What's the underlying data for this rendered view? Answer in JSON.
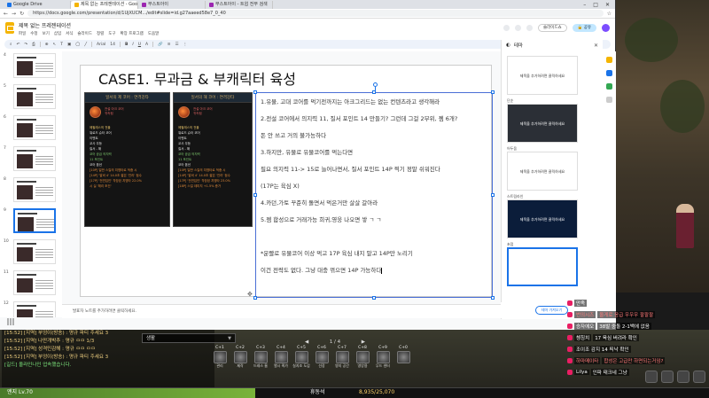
{
  "browser": {
    "tabs": [
      {
        "label": "Google Drive",
        "color": "#1a73e8"
      },
      {
        "label": "제목 없는 프레젠테이션 - Google",
        "color": "#f4b400",
        "active": true
      },
      {
        "label": "부스트아이",
        "color": "#9c27b0"
      },
      {
        "label": "부스트아이 - 트윕 전부 검색",
        "color": "#9c27b0"
      }
    ],
    "url": "https://docs.google.com/presentation/d/1UjXUCM.../edit#slide=id.g27aaeed58e7_0_40"
  },
  "docs": {
    "title": "제목 없는 프레젠테이션",
    "menus": [
      "파일",
      "수정",
      "보기",
      "삽입",
      "서식",
      "슬라이드",
      "정렬",
      "도구",
      "확장 프로그램",
      "도움말"
    ],
    "present_label": "슬라이드쇼",
    "share_label": "공유",
    "toolbar_font": "Arial",
    "toolbar_size": "14",
    "toolbar_items": [
      "B",
      "I",
      "U",
      "A"
    ]
  },
  "filmstrip": {
    "numbers": [
      "4",
      "5",
      "6",
      "7",
      "8",
      "9",
      "10",
      "11",
      "12"
    ],
    "selected_index": 5
  },
  "slide": {
    "title": "CASE1. 무과금 & 부캐릭터 육성",
    "panel_left": {
      "header": "일서의 제 코어 : 연격강타",
      "sub1": "전설 아크 코어",
      "sub2": "귀속됨",
      "lines": [
        "에필레스의 전율",
        "워로드 슈터 코어",
        "이벤트",
        "교사 무등",
        "질서 - 해",
        "코어 공급 의지력",
        "11 포인트",
        "코어 옵션",
        "[10P] 일반 스킬의 치명타로 적중 시",
        "[14P] '알비 4' 14.0초 짧은 '진리' 점수",
        "[17P] '전연입인' 착장된 치명타 22.0%",
        "시 실 '체리 조건'"
      ]
    },
    "panel_right": {
      "header": "일서의 해 코어 : 연격강타",
      "sub1": "전설 아크 코어",
      "sub2": "귀속됨",
      "lines": [
        "에필레스의 전율",
        "워로드 슈터 코어",
        "이벤트",
        "교사 무등",
        "질서 - 해",
        "코어 공급 의지력",
        "11 포인트",
        "코어 옵션",
        "[10P] 일반 스킬의 치명타로 적중 시",
        "[14P] '알비 4' 14.0초 짧은 '진리' 점수",
        "[17P] '전연입인' 착장된 치명타 23.0%",
        "[18P] 스킬 데미지 +1.5% 증가"
      ]
    },
    "text_lines": [
      "1.유물, 고대 코어를 먹기전까지는 아크그리드는 없는 컨텐츠라고 생각해라",
      "2.전설 코어에서 의지력 11, 질서 포인트 14 만들기? 그런데 그걸 2부위, 젬 6개?",
      "돈 안 쓰고 거의 불가능하다",
      "3.하지만, 유물로 유물코어를 먹는다면",
      "필요 의지력 11-> 15로 늘어나면서, 질서 포인트 14P 찍기 정말 쉬워진다",
      "(17P는 육심 X)",
      "4.카던,가토 꾸준히 돌면서 먹은거만 살살 갈아라",
      "5.젬 합성으로 거래가능 희귀,영웅 나오면 쌓 ㄱ ㄱ",
      "",
      "*운빨로 유물코어 이상 먹고 17P 육심 내지 말고 14P만 노리기",
      "이건 전략도 없다. 그냥 대충 꺾으면 14P 가능하다"
    ]
  },
  "notes": {
    "placeholder": "발표자 노트를 추가하려면 클릭하세요."
  },
  "theme": {
    "title": "테마",
    "sections": [
      {
        "label": "",
        "card_text": "제목을 추가하려면 클릭하세요",
        "bg": "#ffffff",
        "fg": "#333333"
      },
      {
        "label": "단순",
        "card_text": "제목을 추가하려면 클릭하세요",
        "bg": "#2b2f36",
        "fg": "#ffffff"
      },
      {
        "label": "어두움",
        "card_text": "제목을 추가하려면 클릭하세요",
        "bg": "#ffffff",
        "fg": "#333333"
      },
      {
        "label": "스트림라인",
        "card_text": "제목을 추가하려면 클릭하세요",
        "bg": "#0b1d3a",
        "fg": "#ffffff"
      },
      {
        "label": "초점",
        "card_text": "",
        "bg": "#ffffff",
        "fg": "#333333"
      }
    ],
    "import_label": "테마 가져오기"
  },
  "game": {
    "chat_lines": [
      {
        "text": "[15:52] [지역] 부엉이(방송) : 명규 파티 주세요 3",
        "color": "#f0d080"
      },
      {
        "text": "[15:52] [지역] 나만개박추 : 명규 ㅁㅁ 1/3",
        "color": "#f0d080"
      },
      {
        "text": "[15:52] [지역] 성격민감해 : 명규 ㅁㅁ ㅁㅁ",
        "color": "#f0d080"
      },
      {
        "text": "[15:52] [지역] 부엉이(방송) : 명규 파티 주세요 3",
        "color": "#f0d080"
      },
      {
        "text": "[길드] 올라인나인 업속했습니다.",
        "color": "#7ee87e"
      }
    ],
    "chat_channel": "생활",
    "page": "1 / 4",
    "skills": [
      {
        "key": "C+1",
        "label": "관리"
      },
      {
        "key": "C+2",
        "label": "제작"
      },
      {
        "key": "C+3",
        "label": "드레스 룸"
      },
      {
        "key": "C+4",
        "label": "열시 퀵가"
      },
      {
        "key": "C+5",
        "label": "실지조 도감"
      },
      {
        "key": "C+6",
        "label": "선장"
      },
      {
        "key": "C+7",
        "label": "영지 공간"
      },
      {
        "key": "C+8",
        "label": "영앙용"
      },
      {
        "key": "C+9",
        "label": "무드 센터"
      },
      {
        "key": "C+0",
        "label": ""
      }
    ],
    "level": "엔지 Lv.70",
    "status": "휴동석",
    "xp": "8,935/25,070",
    "xp_fraction": 0.36,
    "donations": [
      {
        "name": "",
        "msg": "만족",
        "style": "plain"
      },
      {
        "name": "번의시즈",
        "msg": "올게로 응급 우우우 팔팔팔",
        "style": "red"
      },
      {
        "name": "승자에오",
        "msg": "38발 중돌 2-1백에 없음",
        "style": "plain"
      },
      {
        "name": "쳉칭치",
        "msg": "17 육심 버려라 확인",
        "style": "plain"
      },
      {
        "name": "",
        "msg": "조이조 감지 14 띄낙 확인",
        "style": "orange"
      },
      {
        "name": "하마메이타",
        "msg": "합성은 고급만 하면되는거임?",
        "style": "red"
      },
      {
        "name": "Lilya",
        "msg": "인파 태크네 그냥",
        "style": "plain"
      }
    ]
  }
}
